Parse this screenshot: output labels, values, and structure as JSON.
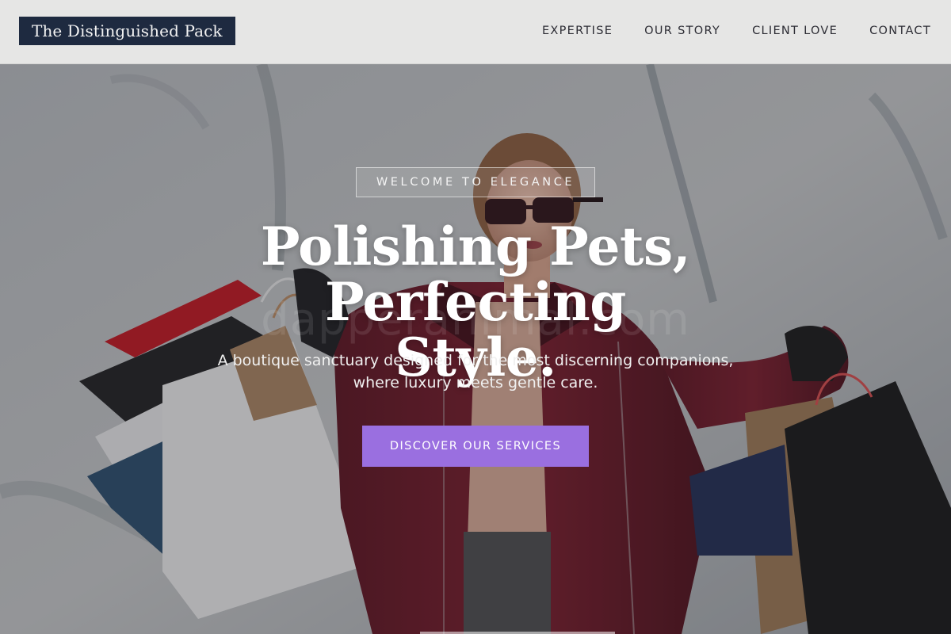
{
  "header": {
    "brand": "The Distinguished Pack",
    "nav": [
      {
        "label": "EXPERTISE"
      },
      {
        "label": "OUR STORY"
      },
      {
        "label": "CLIENT LOVE"
      },
      {
        "label": "CONTACT"
      }
    ]
  },
  "hero": {
    "tag": "WELCOME TO ELEGANCE",
    "title_line1": "Polishing Pets, Perfecting",
    "title_line2": "Style.",
    "subtitle_line1": "A boutique sanctuary designed for the most discerning companions,",
    "subtitle_line2": "where luxury meets gentle care.",
    "cta_label": "DISCOVER OUR SERVICES",
    "watermark": "dapperanimal.com"
  },
  "colors": {
    "header_bg": "#e6e6e5",
    "brand_bg": "#1e2a40",
    "cta_bg": "#9a6fe0"
  }
}
